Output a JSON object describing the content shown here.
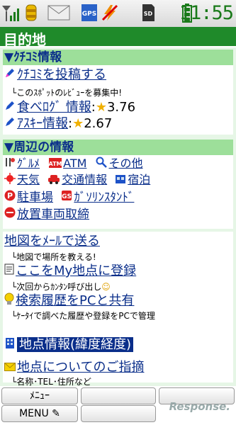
{
  "status": {
    "time": "11:55",
    "icons": [
      "signal-antenna-icon",
      "lighthouse-icon",
      "mail-envelope-icon",
      "gps-icon",
      "no-flash-icon",
      "sd-card-icon",
      "battery-icon"
    ]
  },
  "title": "目的地",
  "review_section": {
    "heading": "▼ｸﾁｺﾐ情報",
    "post_link": "ｸﾁｺﾐを投稿する",
    "post_note": "このｽﾎﾟｯﾄのﾚﾋﾞｭｰを募集中!",
    "tabelog_link": "食べﾛｸﾞ 情報",
    "tabelog_score": "3.76",
    "ascii_link": "ｱｽｷｰ情報",
    "ascii_score": "2.67"
  },
  "nearby_section": {
    "heading": "▼周辺の情報",
    "items": [
      "ｸﾞﾙﾒ",
      "ATM",
      "その他",
      "天気",
      "交通情報",
      "宿泊",
      "駐車場",
      "ｶﾞｿﾘﾝｽﾀﾝﾄﾞ",
      "放置車両取締"
    ]
  },
  "actions": {
    "mail_link": "地図をﾒｰﾙで送る",
    "mail_note": "└地図で場所を教える!",
    "myspot_link": "ここをMy地点に登録",
    "myspot_note": "└次回からｶﾝﾀﾝ呼び出し",
    "history_link": "検索履歴をPCと共有",
    "history_note": "└ｹｰﾀｲで調べた履歴や登録をPCで管理",
    "info_link": "地点情報(緯度経度)",
    "report_link": "地点についてのご指摘",
    "report_note": "└名称･TEL･住所など"
  },
  "softkeys": {
    "left_top": "ﾒﾆｭｰ",
    "left_bottom": "MENU"
  },
  "watermark": "Response."
}
